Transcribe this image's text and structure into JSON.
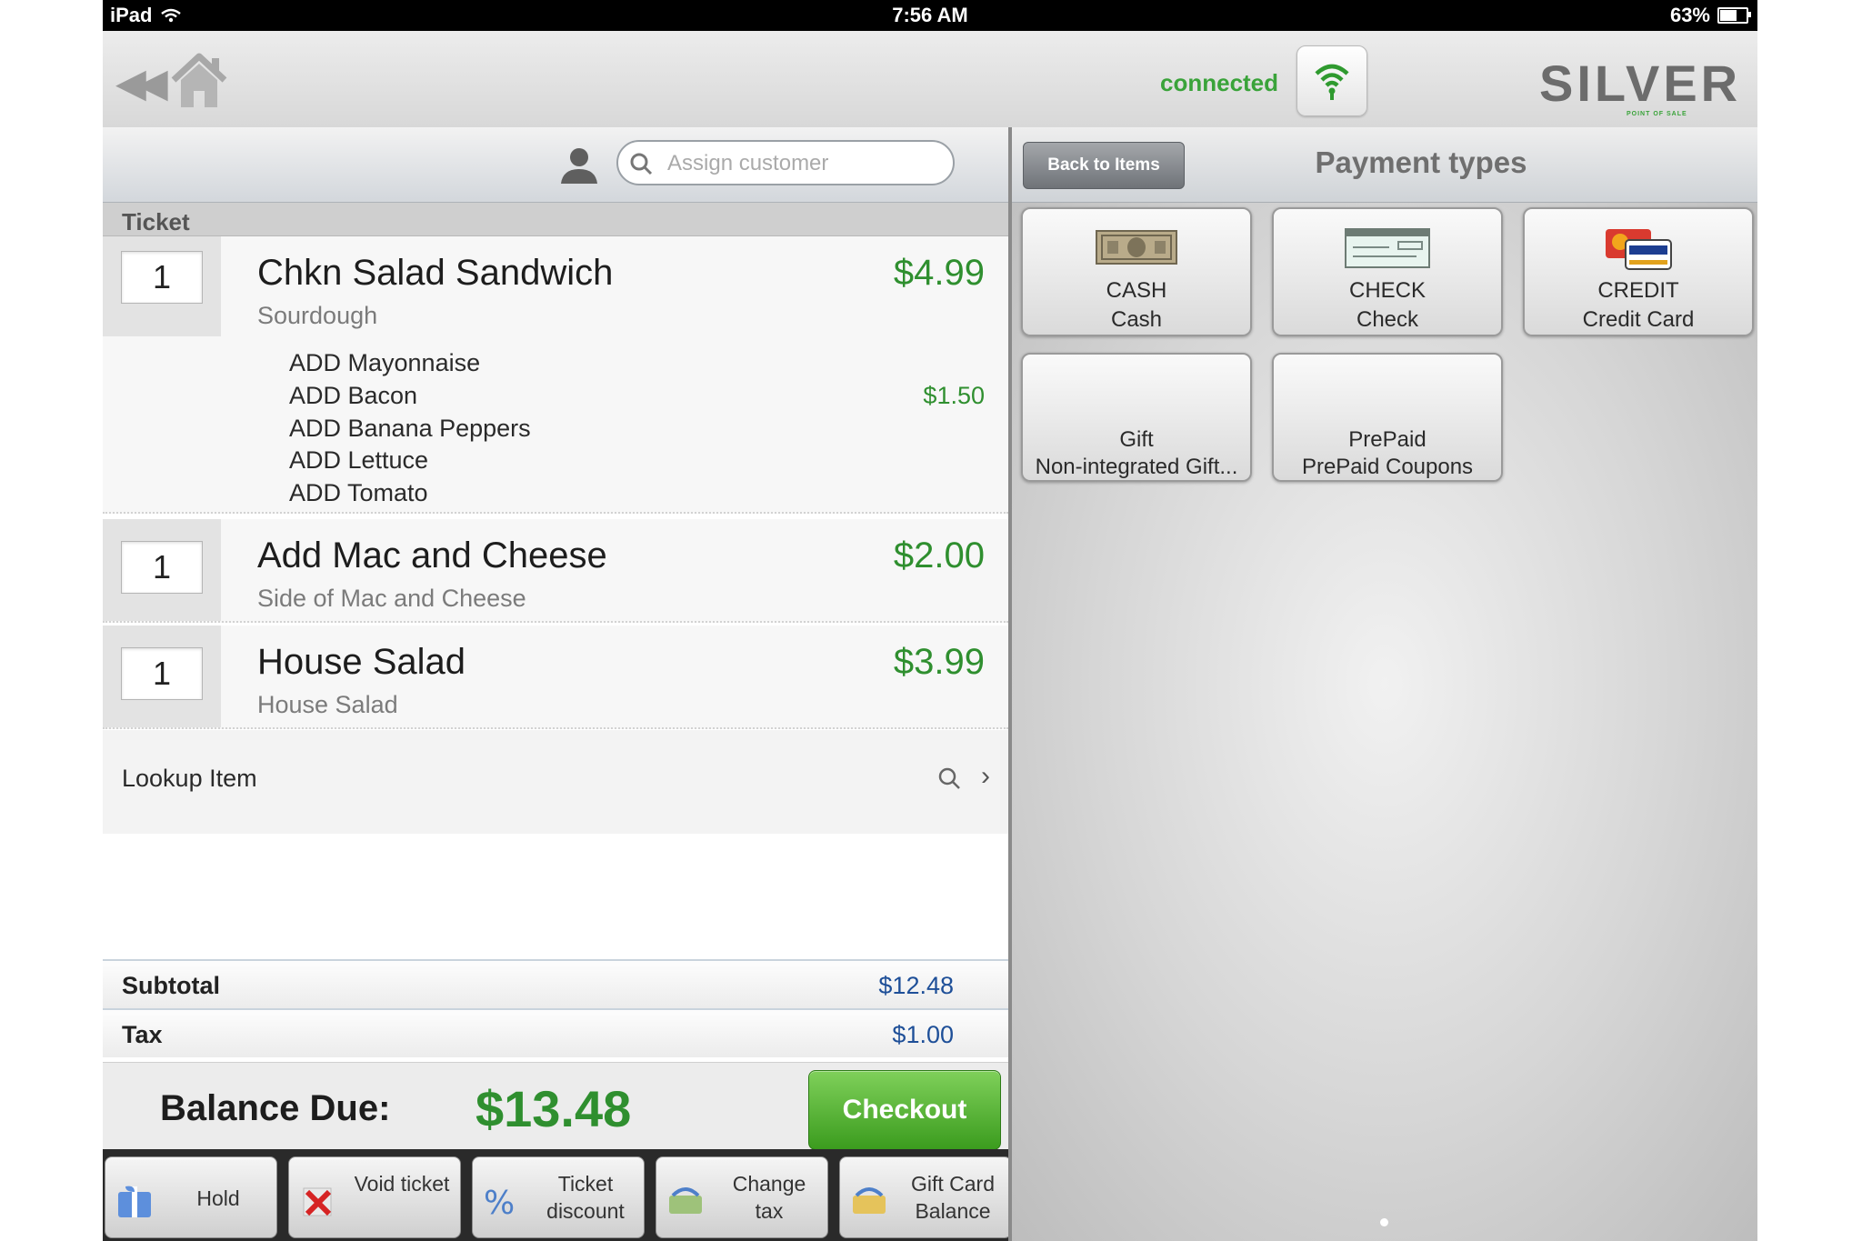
{
  "status_bar": {
    "device": "iPad",
    "time": "7:56 AM",
    "battery": "63%"
  },
  "header": {
    "connection_status": "connected",
    "logo_text": "SILVER",
    "logo_subtext": "POINT OF SALE"
  },
  "customer": {
    "search_placeholder": "Assign customer"
  },
  "ticket": {
    "header": "Ticket",
    "items": [
      {
        "qty": "1",
        "name": "Chkn Salad Sandwich",
        "sub": "Sourdough",
        "price": "$4.99",
        "modifiers": [
          {
            "label": "ADD Mayonnaise",
            "price": ""
          },
          {
            "label": "ADD Bacon",
            "price": "$1.50"
          },
          {
            "label": "ADD Banana Peppers",
            "price": ""
          },
          {
            "label": "ADD Lettuce",
            "price": ""
          },
          {
            "label": "ADD Tomato",
            "price": ""
          }
        ]
      },
      {
        "qty": "1",
        "name": "Add Mac and Cheese",
        "sub": "Side of Mac and Cheese",
        "price": "$2.00",
        "modifiers": []
      },
      {
        "qty": "1",
        "name": "House Salad",
        "sub": "House Salad",
        "price": "$3.99",
        "modifiers": []
      }
    ],
    "lookup_label": "Lookup Item"
  },
  "totals": {
    "subtotal_label": "Subtotal",
    "subtotal_value": "$12.48",
    "tax_label": "Tax",
    "tax_value": "$1.00",
    "balance_label": "Balance Due:",
    "balance_value": "$13.48",
    "checkout_label": "Checkout"
  },
  "actions": [
    {
      "label": "Hold",
      "icon": "gift-box-icon"
    },
    {
      "label": "Void ticket",
      "icon": "red-x-icon"
    },
    {
      "label": "Ticket discount",
      "icon": "percent-icon"
    },
    {
      "label": "Change tax",
      "icon": "change-tax-icon"
    },
    {
      "label": "Gift Card Balance",
      "icon": "gift-card-icon"
    }
  ],
  "payments": {
    "back_label": "Back to Items",
    "title": "Payment types",
    "types": [
      {
        "code": "CASH",
        "name": "Cash",
        "icon": "cash-icon"
      },
      {
        "code": "CHECK",
        "name": "Check",
        "icon": "check-icon"
      },
      {
        "code": "CREDIT",
        "name": "Credit Card",
        "icon": "credit-card-icon"
      },
      {
        "code": "Gift",
        "name": "Non-integrated Gift...",
        "icon": ""
      },
      {
        "code": "PrePaid",
        "name": "PrePaid Coupons",
        "icon": ""
      }
    ]
  },
  "colors": {
    "price_green": "#2f8f2f",
    "total_blue": "#1e4f98",
    "connected_green": "#3aa33a"
  }
}
